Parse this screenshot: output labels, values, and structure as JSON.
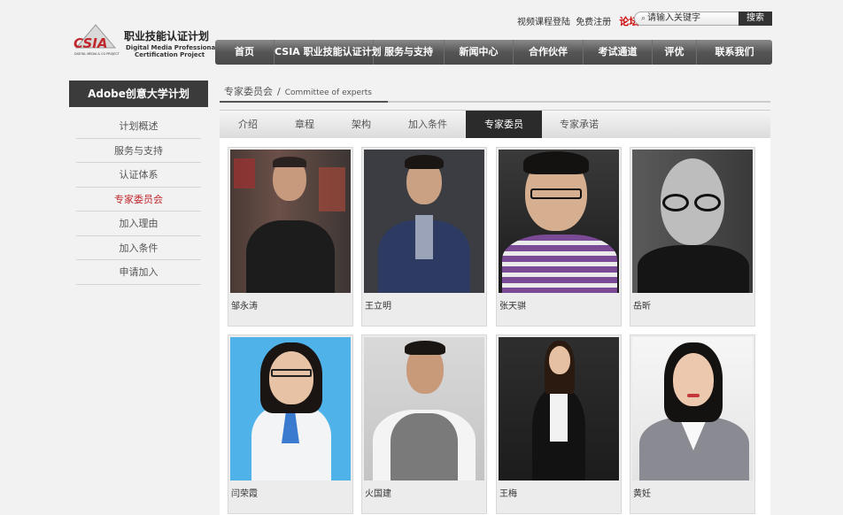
{
  "header": {
    "logo_mark": "CSIA",
    "logo_tagline": "DIGITAL MEDIA & CG PROJECT",
    "logo_title": "职业技能认证计划",
    "logo_subtitle_1": "Digital Media Professional",
    "logo_subtitle_2": "Certification Project",
    "links": {
      "login": "视频课程登陆",
      "register": "免费注册",
      "forum": "论坛"
    },
    "search": {
      "placeholder": "请输入关键字",
      "button": "搜索"
    }
  },
  "nav": [
    "首页",
    "CSIA 职业技能认证计划",
    "服务与支持",
    "新闻中心",
    "合作伙伴",
    "考试通道",
    "评优",
    "联系我们"
  ],
  "sidebar": {
    "title": "Adobe创意大学计划",
    "items": [
      "计划概述",
      "服务与支持",
      "认证体系",
      "专家委员会",
      "加入理由",
      "加入条件",
      "申请加入"
    ],
    "active_index": 3
  },
  "breadcrumb": {
    "zh": "专家委员会",
    "separator": "/",
    "en": "Committee of experts"
  },
  "tabs": {
    "items": [
      "介绍",
      "章程",
      "架构",
      "加入条件",
      "专家委员",
      "专家承诺"
    ],
    "active_index": 4
  },
  "experts": [
    {
      "name": "邹永涛"
    },
    {
      "name": "王立明"
    },
    {
      "name": "张天骐"
    },
    {
      "name": "岳昕"
    },
    {
      "name": "闫荣霞"
    },
    {
      "name": "火国建"
    },
    {
      "name": "王梅"
    },
    {
      "name": "黄妊"
    }
  ],
  "colors": {
    "accent_red": "#c0272d",
    "dark": "#2b2b2b"
  }
}
